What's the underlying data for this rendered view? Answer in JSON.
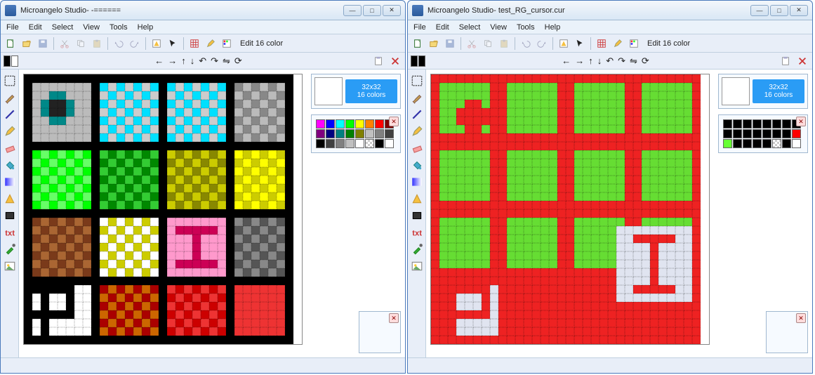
{
  "windows": [
    {
      "title": "Microangelo Studio-  -======",
      "menu": [
        "File",
        "Edit",
        "Select",
        "View",
        "Tools",
        "Help"
      ],
      "toolbar_label": "Edit 16 color",
      "swatches": [
        "#000000",
        "#ffffff"
      ],
      "sizebadge": {
        "line1": "32x32",
        "line2": "16 colors"
      },
      "palette": [
        "#ff00ff",
        "#0000ff",
        "#00ffff",
        "#00ff00",
        "#ffff00",
        "#ff8000",
        "#ff0000",
        "#800000",
        "#800080",
        "#000080",
        "#008080",
        "#008000",
        "#808000",
        "#c0c0c0",
        "#808080",
        "#404040",
        "#000000",
        "#404040",
        "#808080",
        "#c0c0c0",
        "#ffffff",
        "checker",
        "#000000",
        "#ffffff"
      ],
      "canvas_type": "multicolor"
    },
    {
      "title": "Microangelo Studio-  test_RG_cursor.cur",
      "menu": [
        "File",
        "Edit",
        "Select",
        "View",
        "Tools",
        "Help"
      ],
      "toolbar_label": "Edit 16 color",
      "swatches": [
        "#000000",
        "#000000"
      ],
      "sizebadge": {
        "line1": "32x32",
        "line2": "16 colors"
      },
      "palette": [
        "#000000",
        "#000000",
        "#000000",
        "#000000",
        "#000000",
        "#000000",
        "#000000",
        "#000000",
        "#000000",
        "#000000",
        "#000000",
        "#000000",
        "#000000",
        "#000000",
        "#000000",
        "#ff0000",
        "#66ff33",
        "#000000",
        "#000000",
        "#000000",
        "#000000",
        "checker",
        "#000000",
        "#ffffff"
      ],
      "canvas_type": "redgreen"
    }
  ],
  "icons": {
    "new": "new-file-icon",
    "open": "open-folder-icon",
    "save": "save-icon",
    "cut": "cut-icon",
    "copy": "copy-icon",
    "paste": "paste-icon",
    "undo": "undo-icon",
    "redo": "redo-icon",
    "wizard": "wizard-icon",
    "cursor": "cursor-icon",
    "grid": "grid-icon",
    "pencil": "pencil-icon",
    "palette": "palette-icon",
    "select": "select-icon",
    "brush": "brush-icon",
    "line": "line-icon",
    "eraser": "eraser-icon",
    "fill": "fill-icon",
    "gradient": "gradient-icon",
    "shape": "shape-icon",
    "rect": "rect-icon",
    "text": "text-icon",
    "dropper": "dropper-icon",
    "image": "image-icon",
    "min": "minimize-icon",
    "max": "maximize-icon",
    "close": "close-icon",
    "left": "arrow-left-icon",
    "right": "arrow-right-icon",
    "up": "arrow-up-icon",
    "down": "arrow-down-icon",
    "rotl": "rotate-left-icon",
    "rotr": "rotate-right-icon",
    "flip": "flip-icon",
    "cycle": "cycle-icon",
    "clip": "clipboard-icon",
    "del": "delete-icon",
    "target": "target-icon",
    "bars": "color-bars-icon"
  }
}
